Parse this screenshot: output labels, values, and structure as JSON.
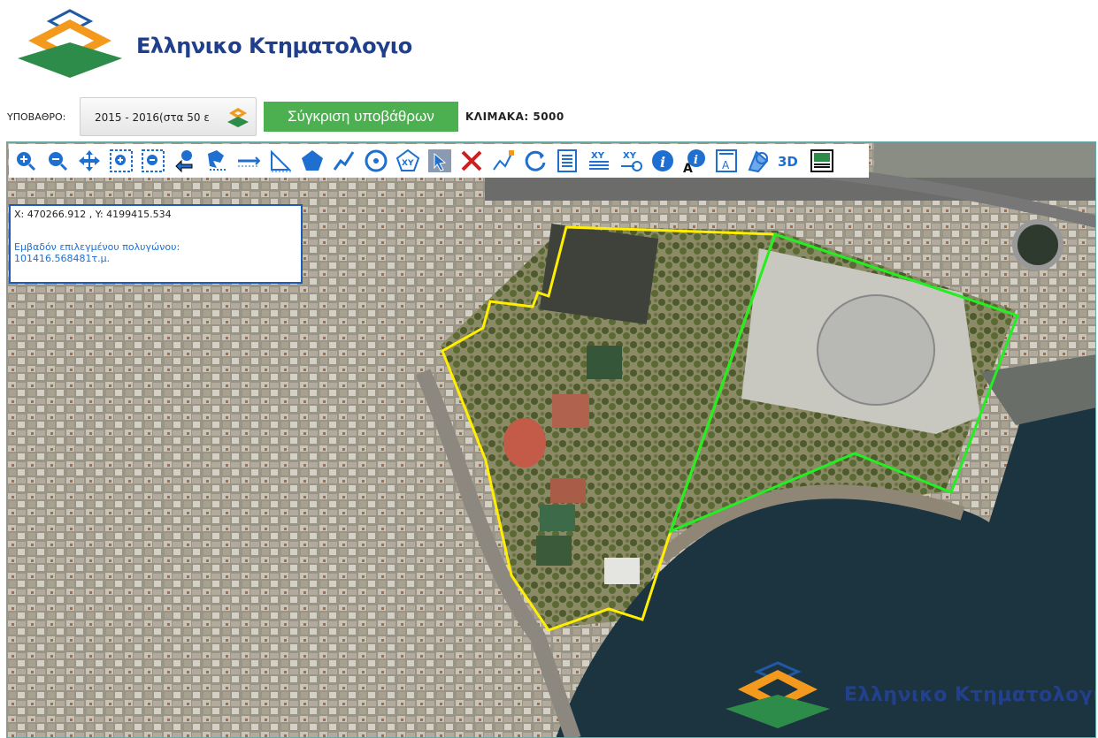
{
  "header": {
    "brand_title": "Ελληνικο Κτηματολογιο"
  },
  "controls": {
    "basemap_label": "ΥΠΟΒΑΘΡΟ:",
    "basemap_value": "2015 - 2016(στα 50 ε",
    "compare_button": "Σύγκριση υποβάθρων",
    "scale_label": "ΚΛΙΜΑΚΑ: 5000"
  },
  "toolbar": {
    "tools": [
      "zoom-in-icon",
      "zoom-out-icon",
      "pan-icon",
      "zoom-box-in-icon",
      "zoom-box-out-icon",
      "previous-view-icon",
      "identify-area-icon",
      "measure-distance-icon",
      "measure-area-icon",
      "polygon-icon",
      "polyline-icon",
      "circle-icon",
      "xy-point-icon",
      "select-icon",
      "clear-icon",
      "edit-vertex-icon",
      "refresh-icon",
      "report-icon",
      "xy-list-icon",
      "goto-xy-icon",
      "info-icon",
      "info-text-icon",
      "label-icon",
      "layers-icon",
      "3d-icon",
      "print-map-icon"
    ],
    "threed_label": "3D",
    "xy_label": "XY"
  },
  "info_panel": {
    "coords": "X: 470266.912 , Y: 4199415.534",
    "area_label": "Εμβαδόν επιλεγμένου πολυγώνου:",
    "area_value": "101416.568481τ.μ."
  },
  "watermark": {
    "text": "Ελληνικο Κτηματολογιο"
  },
  "colors": {
    "brand_blue": "#1f3f8c",
    "compare_green": "#4caf50",
    "polygon_yellow": "#ffee00",
    "polygon_green": "#22ee22",
    "panel_border": "#1e5bb4"
  }
}
